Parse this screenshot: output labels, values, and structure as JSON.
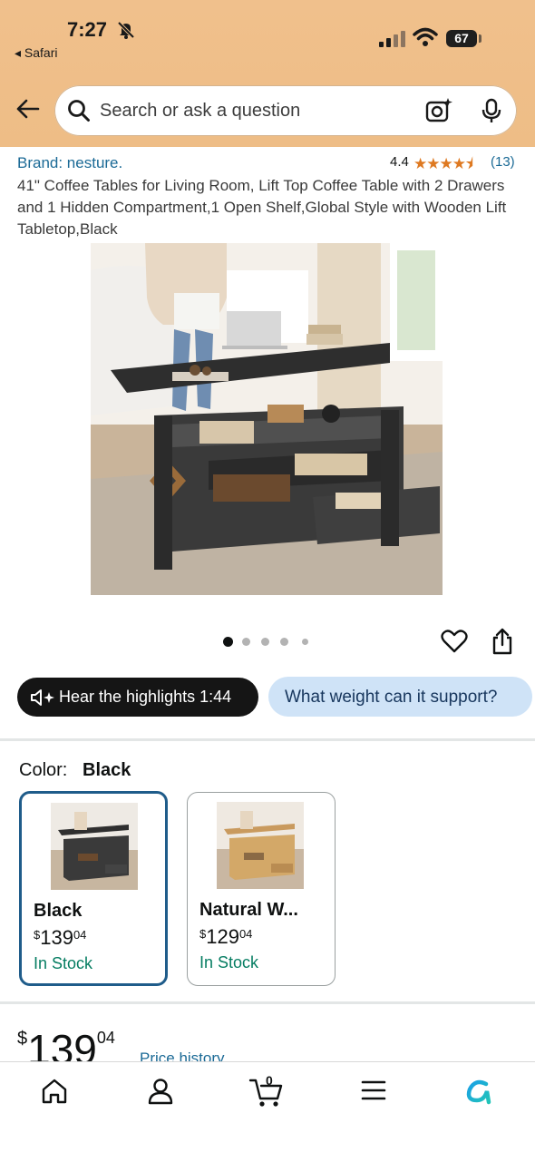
{
  "status_bar": {
    "time": "7:27",
    "back_app": "◂ Safari",
    "battery": "67"
  },
  "search": {
    "placeholder": "Search or ask a question"
  },
  "product": {
    "brand": "Brand: nesture.",
    "rating": "4.4",
    "stars": "★★★★⯨",
    "rating_count": "(13)",
    "title": "41\" Coffee Tables for Living Room, Lift Top Coffee Table with 2 Drawers and 1 Hidden Compartment,1 Open Shelf,Global Style with Wooden Lift Tabletop,Black",
    "image_index": 1,
    "image_count": 5
  },
  "actions": {
    "highlights_label": "Hear the highlights 1:44",
    "ask_label": "What weight can it support?"
  },
  "color": {
    "label": "Color:",
    "selected": "Black",
    "options": [
      {
        "name": "Black",
        "currency": "$",
        "price_whole": "139",
        "price_cents": "04",
        "stock": "In Stock"
      },
      {
        "name": "Natural W...",
        "currency": "$",
        "price_whole": "129",
        "price_cents": "04",
        "stock": "In Stock"
      }
    ]
  },
  "price": {
    "currency": "$",
    "whole": "139",
    "cents": "04",
    "history_link": "Price history"
  },
  "tabbar": {
    "cart_count": "0"
  },
  "colors": {
    "header_bg": "#efbf89",
    "link": "#1b6a96",
    "star": "#de7921",
    "in_stock": "#067d62",
    "selected_border": "#1f5c8a"
  }
}
